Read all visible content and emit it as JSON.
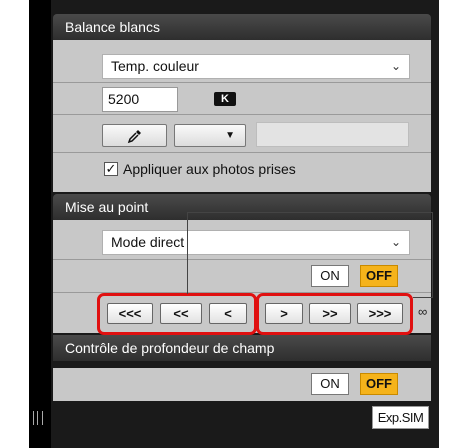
{
  "white_balance": {
    "header": "Balance blancs",
    "mode_select": "Temp. couleur",
    "kelvin_value": "5200",
    "kelvin_badge": "K",
    "eyedropper_icon": "eyedropper-icon",
    "small_select_value": "",
    "apply_checkbox_checked": true,
    "apply_label": "Appliquer aux photos prises"
  },
  "focus": {
    "header": "Mise au point",
    "mode_select": "Mode direct",
    "on_label": "ON",
    "off_label": "OFF",
    "nav_buttons": [
      "<<<",
      "<<",
      "<",
      ">",
      ">>",
      ">>>"
    ],
    "infinity_symbol": "∞"
  },
  "depth_of_field": {
    "header": "Contrôle de profondeur de champ",
    "on_label": "ON",
    "off_label": "OFF"
  },
  "footer": {
    "exp_sim_label": "Exp.SIM"
  },
  "colors": {
    "accent_off": "#f5b31b",
    "highlight_box": "#e01010",
    "panel_bg": "#c8c8c8",
    "header_bg": "#2e2e2e"
  }
}
